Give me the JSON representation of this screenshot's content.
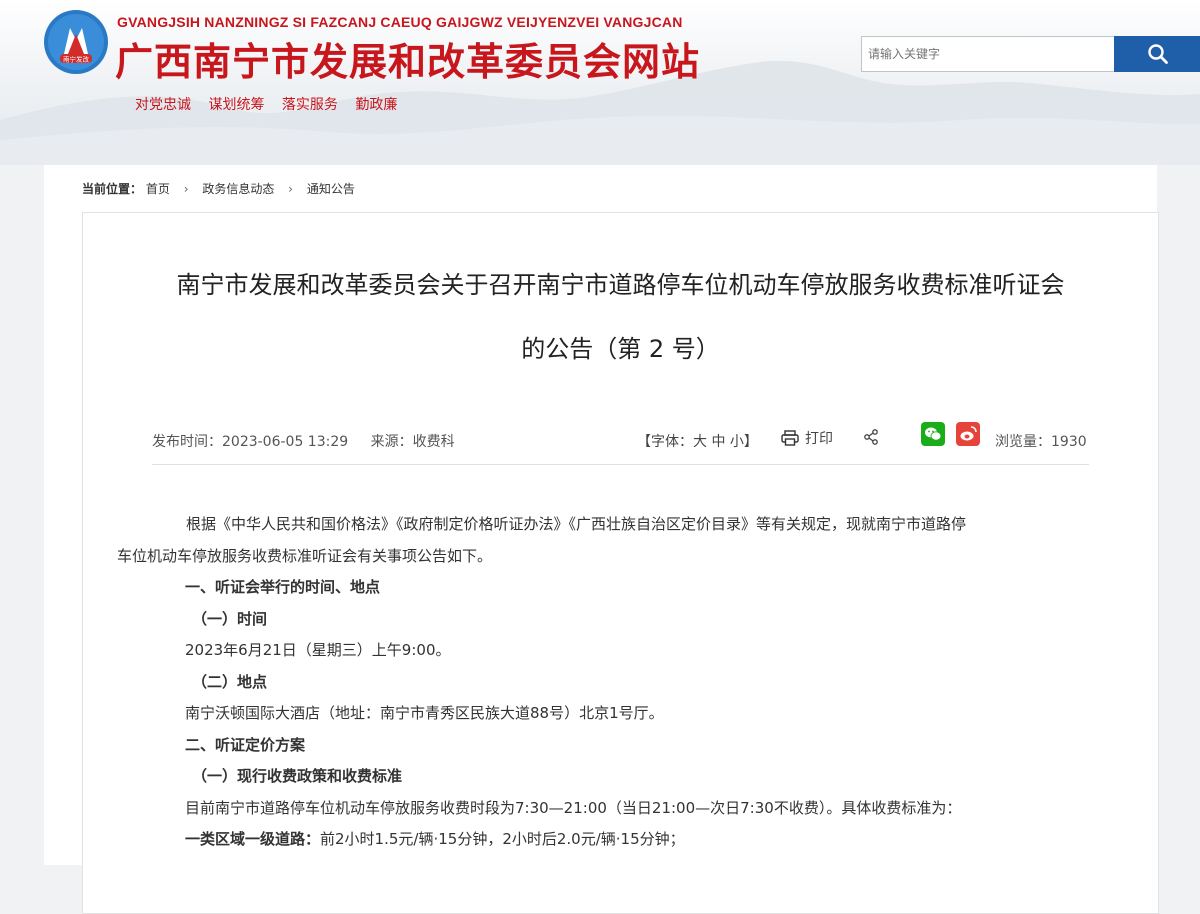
{
  "header": {
    "pinyin": "GVANGJSIH NANZNINGZ SI FAZCANJ CAEUQ GAIJGWZ VEIJYENZVEI VANGJCAN",
    "site_name": "广西南宁市发展和改革委员会网站",
    "logo_text": "南宁发改",
    "slogans": [
      "对党忠诚",
      "谋划统筹",
      "落实服务",
      "勤政廉"
    ],
    "search_placeholder": "请输入关键字",
    "brand_color": "#c8161d",
    "search_button_color": "#1f5ea8"
  },
  "breadcrumb": {
    "label": "当前位置：",
    "items": [
      "首页",
      "政务信息动态",
      "通知公告"
    ]
  },
  "article": {
    "title_line1": "南宁市发展和改革委员会关于召开南宁市道路停车位机动车停放服务收费标准听证会",
    "title_line2": "的公告（第 2 号）",
    "publish_time": "发布时间：2023-06-05 13:29",
    "source": "来源：收费科",
    "font_ctl": "【字体：大 中 小】",
    "print_label": "打印",
    "views": "浏览量：1930",
    "paragraphs": [
      "根据《中华人民共和国价格法》《政府制定价格听证办法》《广西壮族自治区定价目录》等有关规定，现就南宁市道路停",
      "车位机动车停放服务收费标准听证会有关事项公告如下。",
      "一、听证会举行的时间、地点",
      "（一）时间",
      "2023年6月21日（星期三）上午9:00。",
      "（二）地点",
      "南宁沃顿国际大酒店（地址：南宁市青秀区民族大道88号）北京1号厅。",
      "二、听证定价方案",
      "（一）现行收费政策和收费标准",
      "目前南宁市道路停车位机动车停放服务收费时段为7:30—21:00（当日21:00—次日7:30不收费）。具体收费标准为：",
      "一类区域一级道路：",
      "前2小时1.5元/辆·15分钟，2小时后2.0元/辆·15分钟；"
    ]
  }
}
